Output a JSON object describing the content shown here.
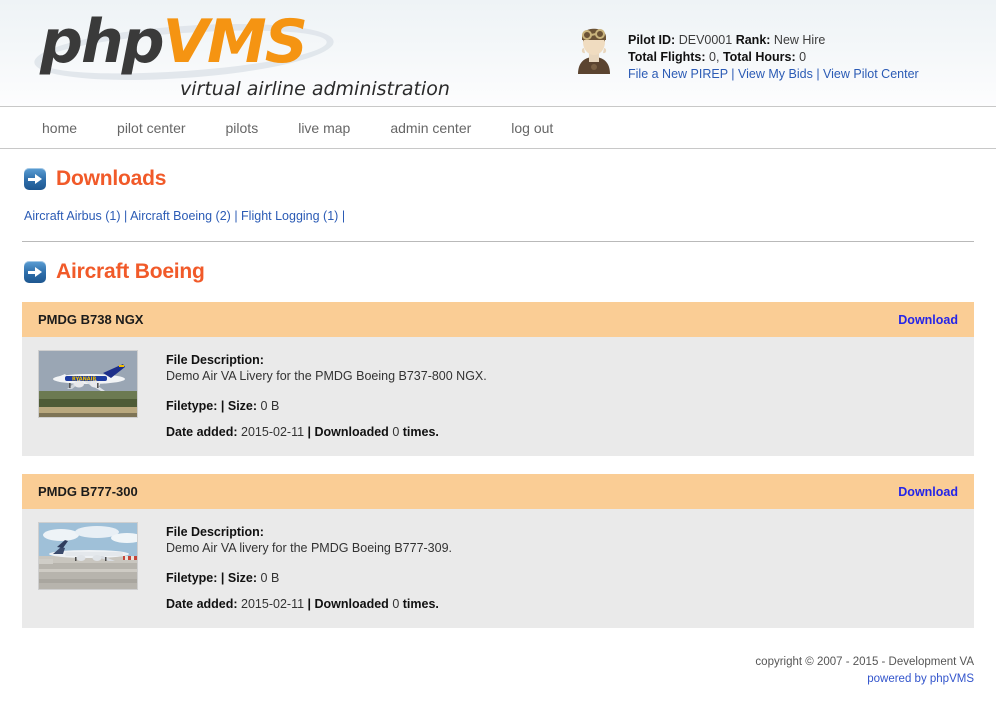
{
  "brand": {
    "logo_php": "php",
    "logo_vms": "VMS",
    "tagline": "virtual airline administration",
    "accent_orange": "#f59412",
    "heading_orange": "#f15a29",
    "link_blue": "#2b5bb5",
    "card_header_peach": "#facd95",
    "card_body_gray": "#eaeaea"
  },
  "pilot": {
    "avatar_icon": "pilot-avatar-icon",
    "id_label": "Pilot ID:",
    "id_value": "DEV0001",
    "rank_label": "Rank:",
    "rank_value": "New Hire",
    "flights_label": "Total Flights:",
    "flights_value": "0,",
    "hours_label": "Total Hours:",
    "hours_value": "0",
    "links": [
      {
        "label": "File a New PIREP"
      },
      {
        "label": "View My Bids"
      },
      {
        "label": "View Pilot Center"
      }
    ],
    "link_separator": "|"
  },
  "nav": {
    "items": [
      {
        "label": "home"
      },
      {
        "label": "pilot center"
      },
      {
        "label": "pilots"
      },
      {
        "label": "live map"
      },
      {
        "label": "admin center"
      },
      {
        "label": "log out"
      }
    ]
  },
  "page": {
    "title": "Downloads",
    "title_icon": "blue-arrow-icon",
    "categories": [
      {
        "label": "Aircraft Airbus (1)"
      },
      {
        "label": "Aircraft Boeing (2)"
      },
      {
        "label": "Flight Logging (1)"
      }
    ],
    "category_separator": "|",
    "section_title": "Aircraft Boeing",
    "section_icon": "blue-arrow-icon"
  },
  "downloads": [
    {
      "name": "PMDG B738 NGX",
      "download_label": "Download",
      "thumbnail_icon": "ryanair-b737-landing-thumbnail",
      "desc_label": "File Description:",
      "description": "Demo Air VA Livery for the PMDG Boeing B737-800 NGX.",
      "filetype_label": "Filetype:",
      "filetype_value": "",
      "size_label": "Size:",
      "size_value": "0 B",
      "date_label": "Date added:",
      "date_value": "2015-02-11",
      "downloaded_label": "Downloaded",
      "downloaded_value": "0",
      "times_label": "times.",
      "pipe": "|"
    },
    {
      "name": "PMDG B777-300",
      "download_label": "Download",
      "thumbnail_icon": "b777-on-ramp-thumbnail",
      "desc_label": "File Description:",
      "description": "Demo Air VA livery for the PMDG Boeing B777-309.",
      "filetype_label": "Filetype:",
      "filetype_value": "",
      "size_label": "Size:",
      "size_value": "0 B",
      "date_label": "Date added:",
      "date_value": "2015-02-11",
      "downloaded_label": "Downloaded",
      "downloaded_value": "0",
      "times_label": "times.",
      "pipe": "|"
    }
  ],
  "footer": {
    "copyright": "copyright © 2007 - 2015 - Development VA",
    "powered_by": "powered by phpVMS"
  }
}
